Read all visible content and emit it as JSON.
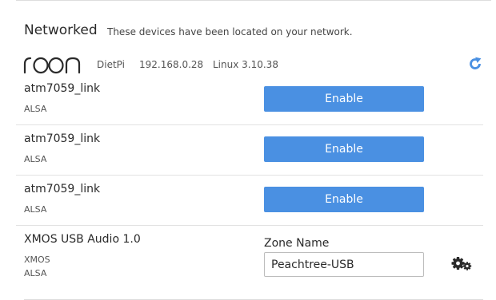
{
  "section": {
    "title": "Networked",
    "description": "These devices have been located on your network."
  },
  "device": {
    "logo_text": "roon",
    "name": "DietPi",
    "ip": "192.168.0.28",
    "os": "Linux 3.10.38",
    "refresh_icon": "refresh-icon",
    "accent_color": "#4a90e2"
  },
  "outputs": [
    {
      "name": "atm7059_link",
      "sub": [
        "ALSA"
      ],
      "action_label": "Enable"
    },
    {
      "name": "atm7059_link",
      "sub": [
        "ALSA"
      ],
      "action_label": "Enable"
    },
    {
      "name": "atm7059_link",
      "sub": [
        "ALSA"
      ],
      "action_label": "Enable"
    },
    {
      "name": "XMOS USB Audio 1.0",
      "sub": [
        "XMOS",
        "ALSA"
      ],
      "zone_label": "Zone Name",
      "zone_value": "Peachtree-USB",
      "settings_icon": "gears-icon"
    }
  ]
}
